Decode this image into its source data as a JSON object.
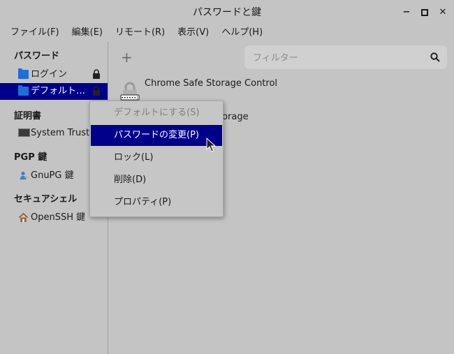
{
  "window": {
    "title": "パスワードと鍵",
    "controls": {
      "minimize": "−",
      "maximize": "□",
      "close": "✕"
    }
  },
  "menubar": [
    "ファイル(F)",
    "編集(E)",
    "リモート(R)",
    "表示(V)",
    "ヘルプ(H)"
  ],
  "sidebar": {
    "sections": [
      {
        "heading": "パスワード",
        "items": [
          {
            "label": "ログイン",
            "icon": "folder-icon",
            "locked": true,
            "selected": false
          },
          {
            "label": "デフォルト…",
            "icon": "folder-icon",
            "locked": true,
            "selected": true
          }
        ]
      },
      {
        "heading": "証明書",
        "items": [
          {
            "label": "System Trust",
            "icon": "monitor-icon"
          }
        ]
      },
      {
        "heading": "PGP 鍵",
        "items": [
          {
            "label": "GnuPG 鍵",
            "icon": "person-key-icon"
          }
        ]
      },
      {
        "heading": "セキュアシェル",
        "items": [
          {
            "label": "OpenSSH 鍵",
            "icon": "home-icon"
          }
        ]
      }
    ]
  },
  "toolbar": {
    "add_label": "+"
  },
  "filter": {
    "placeholder": "フィルター",
    "value": ""
  },
  "items": [
    {
      "name": "Chrome Safe Storage Control",
      "icon": "password-lock-icon"
    },
    {
      "name": "Chrome Safe Storage",
      "icon": "password-lock-icon",
      "visible_fragment": "torage"
    }
  ],
  "context_menu": [
    {
      "label": "デフォルトにする(S)",
      "disabled": true
    },
    {
      "label": "パスワードの変更(P)",
      "highlighted": true
    },
    {
      "label": "ロック(L)"
    },
    {
      "label": "削除(D)"
    },
    {
      "label": "プロパティ(P)"
    }
  ],
  "colors": {
    "selection": "#00008a",
    "background": "#c4c4c4",
    "folder": "#1e6fd9"
  }
}
